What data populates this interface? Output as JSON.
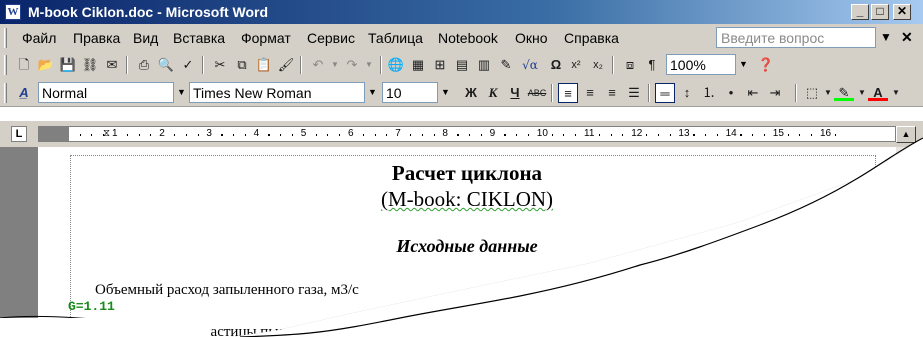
{
  "window": {
    "title": "M-book Ciklon.doc - Microsoft Word",
    "app_icon": "W",
    "controls": {
      "minimize": "_",
      "maximize": "□",
      "close": "✕"
    }
  },
  "menubar": {
    "items": [
      "Файл",
      "Правка",
      "Вид",
      "Вставка",
      "Формат",
      "Сервис",
      "Таблица",
      "Notebook",
      "Окно",
      "Справка"
    ],
    "help_placeholder": "Введите вопрос",
    "doc_close": "✕"
  },
  "toolbar_standard": {
    "icons": [
      "new-icon",
      "open-icon",
      "save-icon",
      "permission-icon",
      "email-icon",
      "print-icon",
      "print-preview-icon",
      "spelling-icon",
      "cut-icon",
      "copy-icon",
      "paste-icon",
      "format-painter-icon",
      "undo-icon",
      "redo-icon",
      "hyperlink-icon",
      "tables-borders-icon",
      "insert-table-icon",
      "insert-excel-icon",
      "columns-icon",
      "drawing-icon",
      "equation-icon",
      "symbol-icon",
      "superscript-icon",
      "subscript-icon",
      "document-map-icon",
      "show-formatting-icon",
      "help-icon"
    ],
    "zoom": "100%"
  },
  "toolbar_formatting": {
    "style": "Normal",
    "font": "Times New Roman",
    "size": "10",
    "bold": "Ж",
    "italic": "К",
    "underline": "Ч",
    "icons": [
      "styles-icon",
      "strikethrough-icon",
      "align-left-icon",
      "align-center-icon",
      "align-right-icon",
      "justify-icon",
      "distributed-icon",
      "numbering-icon",
      "bullets-icon",
      "decrease-indent-icon",
      "increase-indent-icon",
      "borders-icon",
      "highlight-icon",
      "font-color-icon"
    ],
    "highlight_color": "#00ff00",
    "font_color": "#ff0000"
  },
  "ruler": {
    "corner": "L",
    "numbers": [
      "1",
      "2",
      "3",
      "4",
      "5",
      "6",
      "7",
      "8",
      "9",
      "10",
      "11",
      "12",
      "13",
      "14",
      "15",
      "16"
    ]
  },
  "document": {
    "title": "Расчет циклона",
    "subtitle": "(M-book: CIKLON)",
    "heading": "Исходные данные",
    "line1": "Объемный расход запыленного газа, м3/с",
    "code_value": "G=1.11",
    "line2": "частицы пыли, м"
  },
  "colors": {
    "titlebar_start": "#0a246a",
    "titlebar_end": "#a6caf0",
    "chrome": "#d4d0c8",
    "code_green": "#1a8a1a"
  }
}
